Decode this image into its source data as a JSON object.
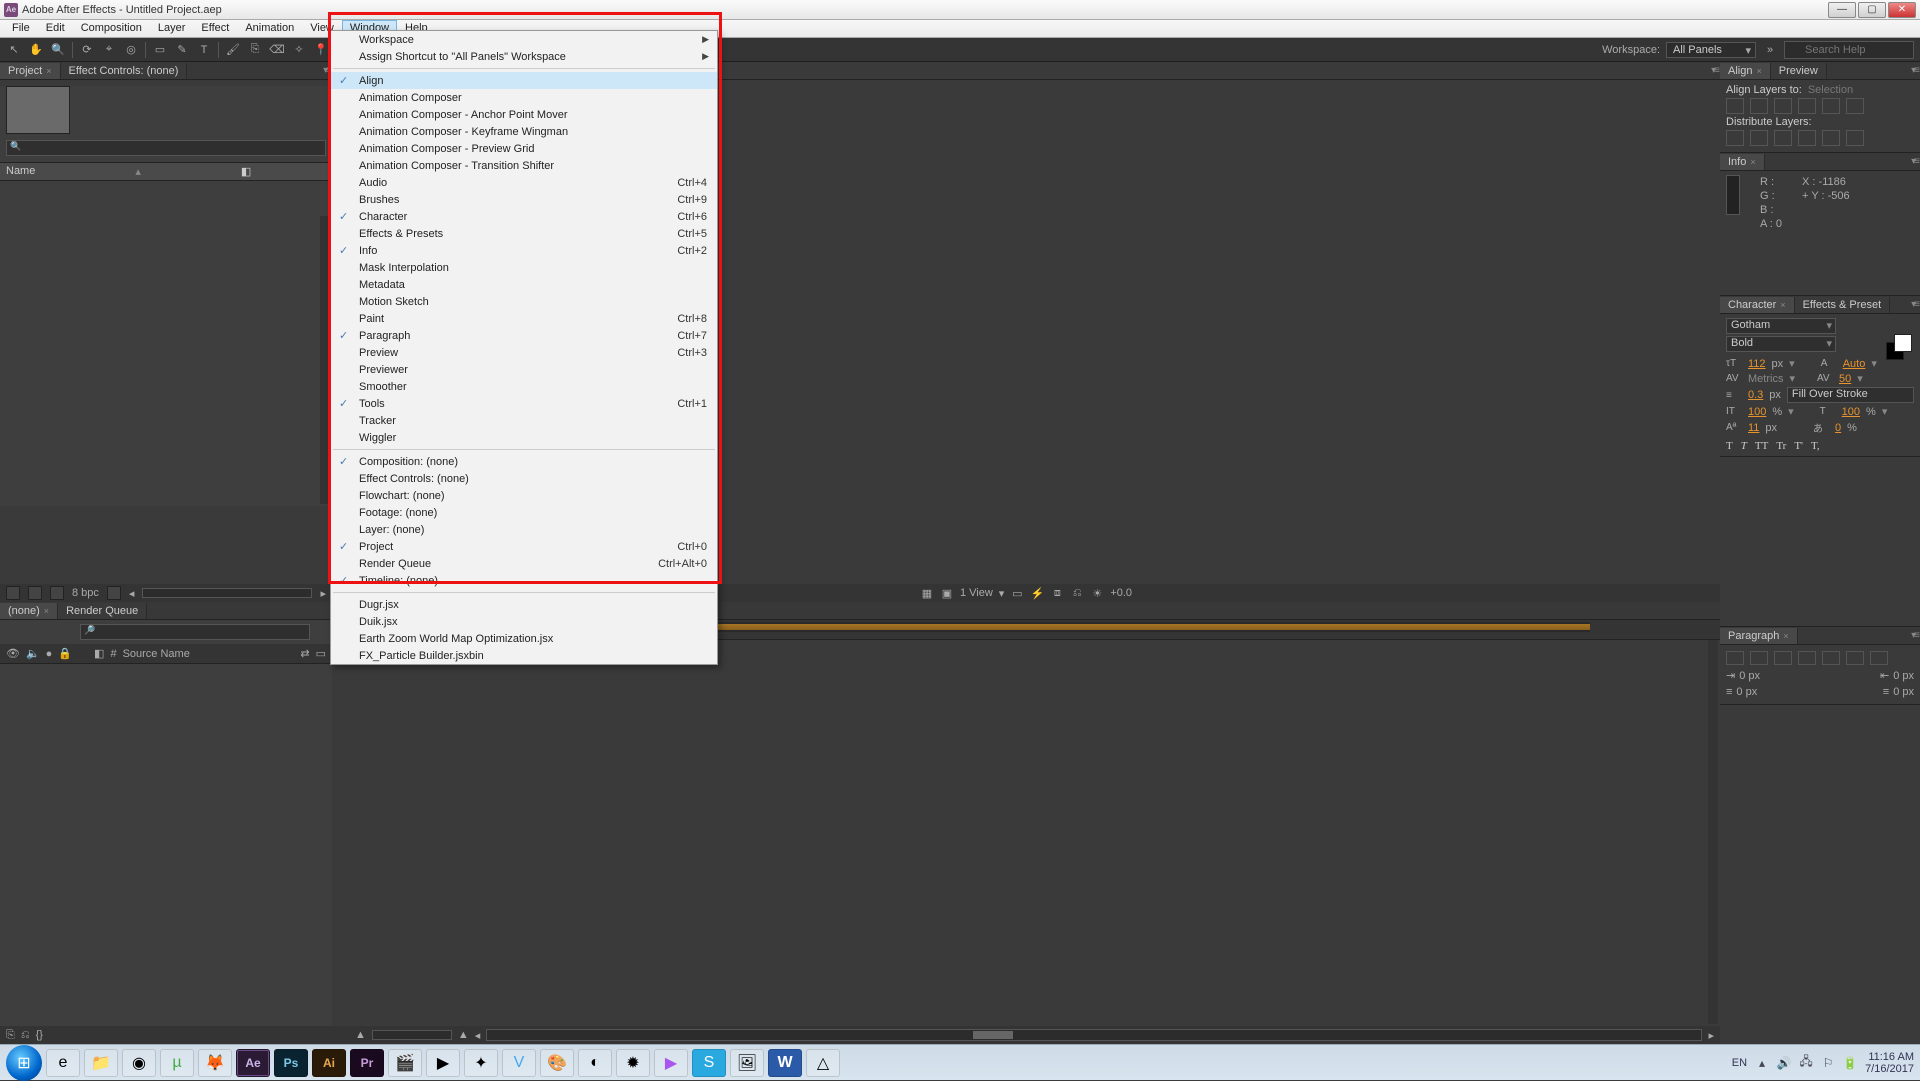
{
  "window": {
    "title": "Adobe After Effects - Untitled Project.aep"
  },
  "menubar": [
    "File",
    "Edit",
    "Composition",
    "Layer",
    "Effect",
    "Animation",
    "View",
    "Window",
    "Help"
  ],
  "menubar_active": "Window",
  "workspace": {
    "label": "Workspace:",
    "value": "All Panels"
  },
  "search": {
    "placeholder": "Search Help"
  },
  "tabs": {
    "project": "Project",
    "effect_controls": "Effect Controls: (none)",
    "comp_none": "Composition: (none)",
    "flowchart_none": "Flowchart: (none)",
    "timeline_none": "(none)",
    "render_queue": "Render Queue",
    "align": "Align",
    "preview": "Preview",
    "info": "Info",
    "character": "Character",
    "effects_presets": "Effects & Preset",
    "paragraph": "Paragraph"
  },
  "project_panel": {
    "col_name": "Name",
    "col_comment": "Comment",
    "bpc": "8 bpc"
  },
  "align_panel": {
    "align_to_label": "Align Layers to:",
    "align_to_value": "Selection",
    "distribute_label": "Distribute Layers:"
  },
  "info_panel": {
    "r": "R :",
    "g": "G :",
    "b": "B :",
    "a": "A : 0",
    "x": "X : -1186",
    "y": "Y : -506",
    "plus": "+"
  },
  "character_panel": {
    "font": "Gotham",
    "style": "Bold",
    "size": "112",
    "size_unit": "px",
    "leading": "Auto",
    "kerning_label": "Metrics",
    "tracking": "50",
    "stroke": "0.3",
    "stroke_unit": "px",
    "fill_mode": "Fill Over Stroke",
    "vscale": "100",
    "hscale": "100",
    "pct": "%",
    "baseline": "11",
    "tsume": "0",
    "styles": [
      "T",
      "T",
      "TT",
      "Tr",
      "T'",
      "T,"
    ]
  },
  "paragraph_panel": {
    "indent_zero": "0 px"
  },
  "comp_footer": {
    "view": "1 View",
    "exposure": "+0.0"
  },
  "timeline": {
    "source_name": "Source Name"
  },
  "dropdown": {
    "groups": [
      [
        {
          "label": "Workspace",
          "sub": true
        },
        {
          "label": "Assign Shortcut to \"All Panels\" Workspace",
          "sub": true
        }
      ],
      [
        {
          "label": "Align",
          "chk": true,
          "hl": true
        },
        {
          "label": "Animation Composer"
        },
        {
          "label": "Animation Composer - Anchor Point Mover"
        },
        {
          "label": "Animation Composer - Keyframe Wingman"
        },
        {
          "label": "Animation Composer - Preview Grid"
        },
        {
          "label": "Animation Composer - Transition Shifter"
        },
        {
          "label": "Audio",
          "accel": "Ctrl+4"
        },
        {
          "label": "Brushes",
          "accel": "Ctrl+9"
        },
        {
          "label": "Character",
          "chk": true,
          "accel": "Ctrl+6"
        },
        {
          "label": "Effects & Presets",
          "accel": "Ctrl+5"
        },
        {
          "label": "Info",
          "chk": true,
          "accel": "Ctrl+2"
        },
        {
          "label": "Mask Interpolation"
        },
        {
          "label": "Metadata"
        },
        {
          "label": "Motion Sketch"
        },
        {
          "label": "Paint",
          "accel": "Ctrl+8"
        },
        {
          "label": "Paragraph",
          "chk": true,
          "accel": "Ctrl+7"
        },
        {
          "label": "Preview",
          "accel": "Ctrl+3"
        },
        {
          "label": "Previewer"
        },
        {
          "label": "Smoother"
        },
        {
          "label": "Tools",
          "chk": true,
          "accel": "Ctrl+1"
        },
        {
          "label": "Tracker"
        },
        {
          "label": "Wiggler"
        }
      ],
      [
        {
          "label": "Composition: (none)",
          "chk": true
        },
        {
          "label": "Effect Controls: (none)"
        },
        {
          "label": "Flowchart: (none)"
        },
        {
          "label": "Footage: (none)"
        },
        {
          "label": "Layer: (none)"
        },
        {
          "label": "Project",
          "chk": true,
          "accel": "Ctrl+0"
        },
        {
          "label": "Render Queue",
          "accel": "Ctrl+Alt+0"
        },
        {
          "label": "Timeline: (none)",
          "chk": true
        }
      ],
      [
        {
          "label": "Dugr.jsx"
        },
        {
          "label": "Duik.jsx"
        },
        {
          "label": "Earth Zoom World Map Optimization.jsx"
        },
        {
          "label": "FX_Particle Builder.jsxbin"
        }
      ]
    ]
  },
  "taskbar": {
    "lang": "EN",
    "time": "11:16 AM",
    "date": "7/16/2017"
  }
}
